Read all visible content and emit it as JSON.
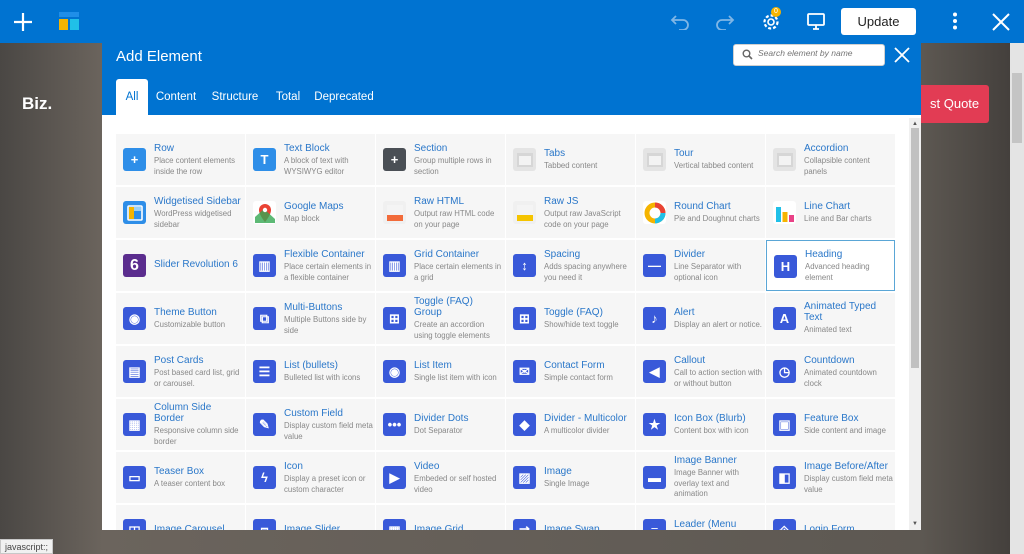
{
  "site": {
    "logo": "Biz.",
    "quote_button": "st Quote"
  },
  "toolbar": {
    "update_label": "Update",
    "notification_count": "0",
    "accent": "#0073d1"
  },
  "modal": {
    "title": "Add Element",
    "search_placeholder": "Search element by name",
    "tabs": [
      "All",
      "Content",
      "Structure",
      "Total",
      "Deprecated"
    ]
  },
  "elements": [
    {
      "name": "Row",
      "desc": "Place content elements inside the row",
      "icon": "plus-icon",
      "color": "#2e8ee8"
    },
    {
      "name": "Text Block",
      "desc": "A block of text with WYSIWYG editor",
      "icon": "text-t-icon",
      "color": "#2e8ee8"
    },
    {
      "name": "Section",
      "desc": "Group multiple rows in section",
      "icon": "plus-icon",
      "color": "#4a4f55"
    },
    {
      "name": "Tabs",
      "desc": "Tabbed content",
      "icon": "tabs-icon",
      "color": "#e4e4e4"
    },
    {
      "name": "Tour",
      "desc": "Vertical tabbed content",
      "icon": "tour-icon",
      "color": "#e4e4e4"
    },
    {
      "name": "Accordion",
      "desc": "Collapsible content panels",
      "icon": "accordion-icon",
      "color": "#e4e4e4"
    },
    {
      "name": "Widgetised Sidebar",
      "desc": "WordPress widgetised sidebar",
      "icon": "sidebar-icon",
      "color": "#2e8ee8"
    },
    {
      "name": "Google Maps",
      "desc": "Map block",
      "icon": "map-pin-icon",
      "color": "#ffffff"
    },
    {
      "name": "Raw HTML",
      "desc": "Output raw HTML code on your page",
      "icon": "raw-html-icon",
      "color": "#f0f0f0"
    },
    {
      "name": "Raw JS",
      "desc": "Output raw JavaScript code on your page",
      "icon": "raw-js-icon",
      "color": "#f0f0f0"
    },
    {
      "name": "Round Chart",
      "desc": "Pie and Doughnut charts",
      "icon": "round-chart-icon",
      "color": "#ffffff"
    },
    {
      "name": "Line Chart",
      "desc": "Line and Bar charts",
      "icon": "line-chart-icon",
      "color": "#ffffff"
    },
    {
      "name": "Slider Revolution 6",
      "desc": "",
      "icon": "slider-revolution-icon",
      "color": "#5b2d8e"
    },
    {
      "name": "Flexible Container",
      "desc": "Place certain elements in a flexible container",
      "icon": "columns-icon",
      "color": "#3959d9"
    },
    {
      "name": "Grid Container",
      "desc": "Place certain elements in a grid",
      "icon": "columns-icon",
      "color": "#3959d9"
    },
    {
      "name": "Spacing",
      "desc": "Adds spacing anywhere you need it",
      "icon": "spacing-icon",
      "color": "#3959d9"
    },
    {
      "name": "Divider",
      "desc": "Line Separator with optional icon",
      "icon": "divider-icon",
      "color": "#3959d9"
    },
    {
      "name": "Heading",
      "desc": "Advanced heading element",
      "icon": "heading-h-icon",
      "color": "#3959d9"
    },
    {
      "name": "Theme Button",
      "desc": "Customizable button",
      "icon": "cursor-click-icon",
      "color": "#3959d9"
    },
    {
      "name": "Multi-Buttons",
      "desc": "Multiple Buttons side by side",
      "icon": "multi-buttons-icon",
      "color": "#3959d9"
    },
    {
      "name": "Toggle (FAQ) Group",
      "desc": "Create an accordion using toggle elements",
      "icon": "plus-square-icon",
      "color": "#3959d9"
    },
    {
      "name": "Toggle (FAQ)",
      "desc": "Show/hide text toggle",
      "icon": "plus-square-icon",
      "color": "#3959d9"
    },
    {
      "name": "Alert",
      "desc": "Display an alert or notice.",
      "icon": "bell-icon",
      "color": "#3959d9"
    },
    {
      "name": "Animated Typed Text",
      "desc": "Animated text",
      "icon": "typed-text-icon",
      "color": "#3959d9"
    },
    {
      "name": "Post Cards",
      "desc": "Post based card list, grid or carousel.",
      "icon": "post-cards-icon",
      "color": "#3959d9"
    },
    {
      "name": "List (bullets)",
      "desc": "Bulleted list with icons",
      "icon": "list-icon",
      "color": "#3959d9"
    },
    {
      "name": "List Item",
      "desc": "Single list item with icon",
      "icon": "list-item-icon",
      "color": "#3959d9"
    },
    {
      "name": "Contact Form",
      "desc": "Simple contact form",
      "icon": "envelope-icon",
      "color": "#3959d9"
    },
    {
      "name": "Callout",
      "desc": "Call to action section with or without button",
      "icon": "megaphone-icon",
      "color": "#3959d9"
    },
    {
      "name": "Countdown",
      "desc": "Animated countdown clock",
      "icon": "clock-icon",
      "color": "#3959d9"
    },
    {
      "name": "Column Side Border",
      "desc": "Responsive column side border",
      "icon": "border-icon",
      "color": "#3959d9"
    },
    {
      "name": "Custom Field",
      "desc": "Display custom field meta value",
      "icon": "wrench-icon",
      "color": "#3959d9"
    },
    {
      "name": "Divider Dots",
      "desc": "Dot Separator",
      "icon": "dots-icon",
      "color": "#3959d9"
    },
    {
      "name": "Divider - Multicolor",
      "desc": "A multicolor divider",
      "icon": "paint-bucket-icon",
      "color": "#3959d9"
    },
    {
      "name": "Icon Box (Blurb)",
      "desc": "Content box with icon",
      "icon": "star-icon",
      "color": "#3959d9"
    },
    {
      "name": "Feature Box",
      "desc": "Side content and image",
      "icon": "feature-box-icon",
      "color": "#3959d9"
    },
    {
      "name": "Teaser Box",
      "desc": "A teaser content box",
      "icon": "teaser-box-icon",
      "color": "#3959d9"
    },
    {
      "name": "Icon",
      "desc": "Display a preset icon or custom character",
      "icon": "bolt-icon",
      "color": "#3959d9"
    },
    {
      "name": "Video",
      "desc": "Embeded or self hosted video",
      "icon": "play-icon",
      "color": "#3959d9"
    },
    {
      "name": "Image",
      "desc": "Single Image",
      "icon": "image-icon",
      "color": "#3959d9"
    },
    {
      "name": "Image Banner",
      "desc": "Image Banner with overlay text and animation",
      "icon": "banner-icon",
      "color": "#3959d9"
    },
    {
      "name": "Image Before/After",
      "desc": "Display custom field meta value",
      "icon": "before-after-icon",
      "color": "#3959d9"
    },
    {
      "name": "Image Carousel",
      "desc": "",
      "icon": "carousel-icon",
      "color": "#3959d9"
    },
    {
      "name": "Image Slider",
      "desc": "",
      "icon": "slider-icon",
      "color": "#3959d9"
    },
    {
      "name": "Image Grid",
      "desc": "",
      "icon": "grid-icon",
      "color": "#3959d9"
    },
    {
      "name": "Image Swap",
      "desc": "",
      "icon": "swap-icon",
      "color": "#3959d9"
    },
    {
      "name": "Leader (Menu Items)",
      "desc": "",
      "icon": "leader-icon",
      "color": "#3959d9"
    },
    {
      "name": "Login Form",
      "desc": "",
      "icon": "login-icon",
      "color": "#3959d9"
    }
  ],
  "status_bar": "javascript:;"
}
